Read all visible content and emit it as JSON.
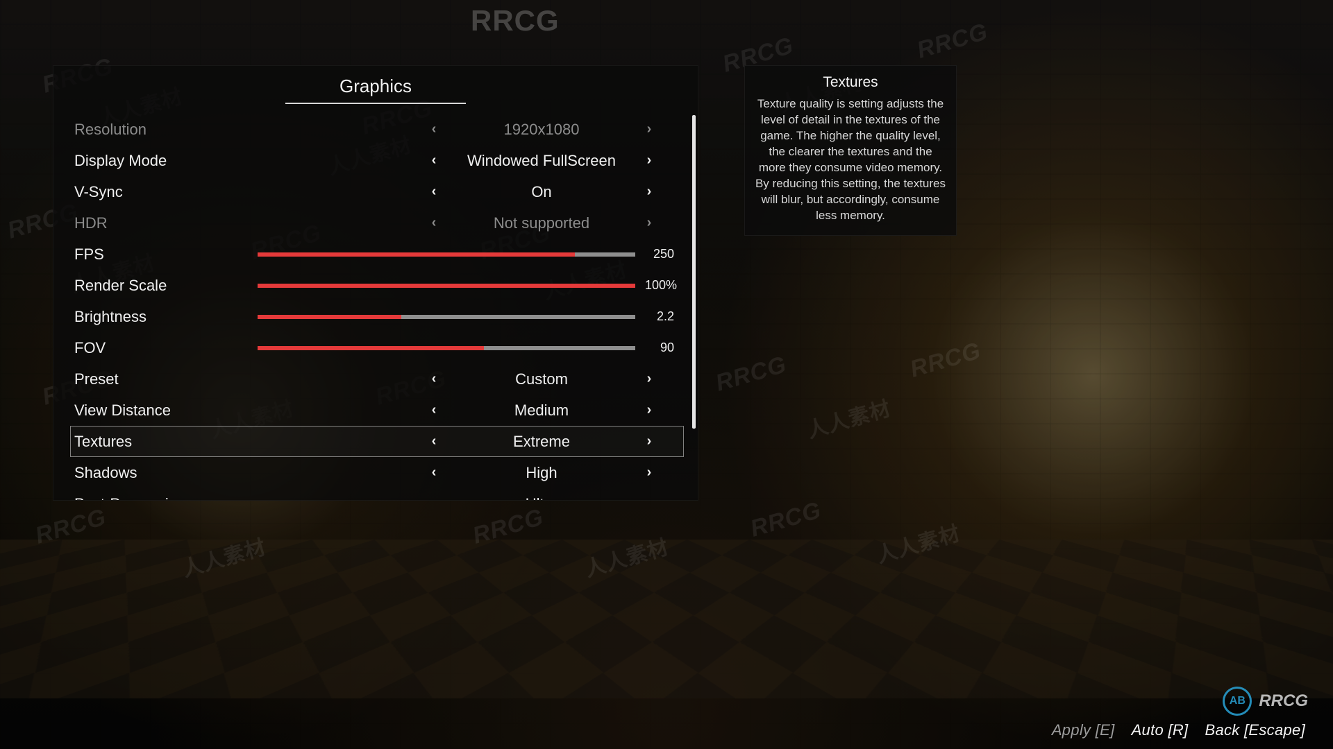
{
  "watermark_text": "RRCG",
  "watermark_cn": "人人素材",
  "panel": {
    "title": "Graphics"
  },
  "options": [
    {
      "kind": "select",
      "key": "resolution",
      "label": "Resolution",
      "value": "1920x1080",
      "dim": true
    },
    {
      "kind": "select",
      "key": "display_mode",
      "label": "Display Mode",
      "value": "Windowed FullScreen",
      "dim": false
    },
    {
      "kind": "select",
      "key": "vsync",
      "label": "V-Sync",
      "value": "On",
      "dim": false
    },
    {
      "kind": "select",
      "key": "hdr",
      "label": "HDR",
      "value": "Not supported",
      "dim": true
    },
    {
      "kind": "slider",
      "key": "fps",
      "label": "FPS",
      "value_text": "250",
      "fill_pct": 84
    },
    {
      "kind": "slider",
      "key": "render_scale",
      "label": "Render Scale",
      "value_text": "100%",
      "fill_pct": 100
    },
    {
      "kind": "slider",
      "key": "brightness",
      "label": "Brightness",
      "value_text": "2.2",
      "fill_pct": 38
    },
    {
      "kind": "slider",
      "key": "fov",
      "label": "FOV",
      "value_text": "90",
      "fill_pct": 60
    },
    {
      "kind": "select",
      "key": "preset",
      "label": "Preset",
      "value": "Custom",
      "dim": false
    },
    {
      "kind": "select",
      "key": "view_distance",
      "label": "View Distance",
      "value": "Medium",
      "dim": false
    },
    {
      "kind": "select",
      "key": "textures",
      "label": "Textures",
      "value": "Extreme",
      "dim": false,
      "highlight": true
    },
    {
      "kind": "select",
      "key": "shadows",
      "label": "Shadows",
      "value": "High",
      "dim": false
    },
    {
      "kind": "select",
      "key": "postproc",
      "label": "Post-Processing",
      "value": "Ultra",
      "dim": false
    }
  ],
  "tooltip": {
    "title": "Textures",
    "body": "Texture quality is setting adjusts the level of detail in the textures of the game. The higher the quality level, the clearer the textures and the more they consume video memory. By reducing this setting, the textures will blur, but accordingly, consume less memory."
  },
  "footer": {
    "apply": "Apply [E]",
    "auto": "Auto [R]",
    "back": "Back [Escape]"
  },
  "logo": {
    "disc": "AB",
    "text": "RRCG"
  },
  "glyphs": {
    "left": "‹",
    "right": "›"
  }
}
